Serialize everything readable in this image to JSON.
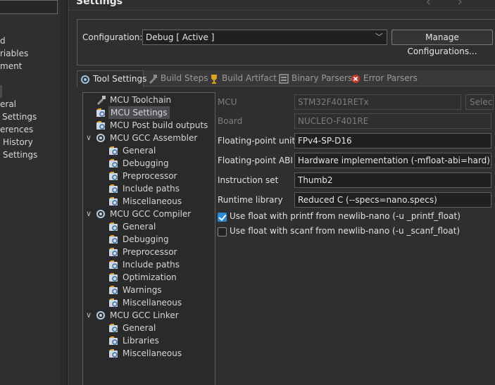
{
  "left_nav": {
    "items": [
      {
        "label": "d"
      },
      {
        "label": "riables"
      },
      {
        "label": "ment"
      },
      {
        "label": "eral"
      },
      {
        "label": "Settings"
      },
      {
        "label": "erences"
      },
      {
        "label": "History"
      },
      {
        "label": "Settings"
      }
    ]
  },
  "page": {
    "title": "Settings",
    "nav_arrows": "‹ ›"
  },
  "configuration": {
    "label": "Configuration:",
    "value": "Debug  [ Active ]",
    "manage_label": "Manage Configurations..."
  },
  "tabs": [
    {
      "label": "Tool Settings",
      "icon": "tool-settings-icon",
      "active": true
    },
    {
      "label": "Build Steps",
      "icon": "build-steps-icon",
      "active": false
    },
    {
      "label": "Build Artifact",
      "icon": "build-artifact-icon",
      "active": false
    },
    {
      "label": "Binary Parsers",
      "icon": "binary-parsers-icon",
      "active": false
    },
    {
      "label": "Error Parsers",
      "icon": "error-parsers-icon",
      "active": false
    }
  ],
  "tree": [
    {
      "label": "MCU Toolchain",
      "icon": "toolchain-icon"
    },
    {
      "label": "MCU Settings",
      "icon": "settings-icon",
      "selected": true
    },
    {
      "label": "MCU Post build outputs",
      "icon": "settings-icon"
    },
    {
      "label": "MCU GCC Assembler",
      "icon": "tool-icon",
      "expanded": true
    },
    {
      "label": "General",
      "icon": "settings-icon"
    },
    {
      "label": "Debugging",
      "icon": "settings-icon"
    },
    {
      "label": "Preprocessor",
      "icon": "settings-icon"
    },
    {
      "label": "Include paths",
      "icon": "settings-icon"
    },
    {
      "label": "Miscellaneous",
      "icon": "settings-icon"
    },
    {
      "label": "MCU GCC Compiler",
      "icon": "tool-icon",
      "expanded": true
    },
    {
      "label": "General",
      "icon": "settings-icon"
    },
    {
      "label": "Debugging",
      "icon": "settings-icon"
    },
    {
      "label": "Preprocessor",
      "icon": "settings-icon"
    },
    {
      "label": "Include paths",
      "icon": "settings-icon"
    },
    {
      "label": "Optimization",
      "icon": "settings-icon"
    },
    {
      "label": "Warnings",
      "icon": "settings-icon"
    },
    {
      "label": "Miscellaneous",
      "icon": "settings-icon"
    },
    {
      "label": "MCU GCC Linker",
      "icon": "tool-icon",
      "expanded": true
    },
    {
      "label": "General",
      "icon": "settings-icon"
    },
    {
      "label": "Libraries",
      "icon": "settings-icon"
    },
    {
      "label": "Miscellaneous",
      "icon": "settings-icon"
    }
  ],
  "settings": {
    "mcu_label": "MCU",
    "mcu_value": "STM32F401RETx",
    "select_label": "Select...",
    "board_label": "Board",
    "board_value": "NUCLEO-F401RE",
    "fpu_label": "Floating-point unit",
    "fpu_value": "FPv4-SP-D16",
    "fpabi_label": "Floating-point ABI",
    "fpabi_value": "Hardware implementation (-mfloat-abi=hard)",
    "iset_label": "Instruction set",
    "iset_value": "Thumb2",
    "runtime_label": "Runtime library",
    "runtime_value": "Reduced C (--specs=nano.specs)",
    "printf_label": "Use float with printf from newlib-nano (-u _printf_float)",
    "printf_checked": true,
    "scanf_label": "Use float with scanf from newlib-nano (-u _scanf_float)",
    "scanf_checked": false
  },
  "colors": {
    "accent": "#2a8cd6",
    "background": "#2f2f2f"
  }
}
